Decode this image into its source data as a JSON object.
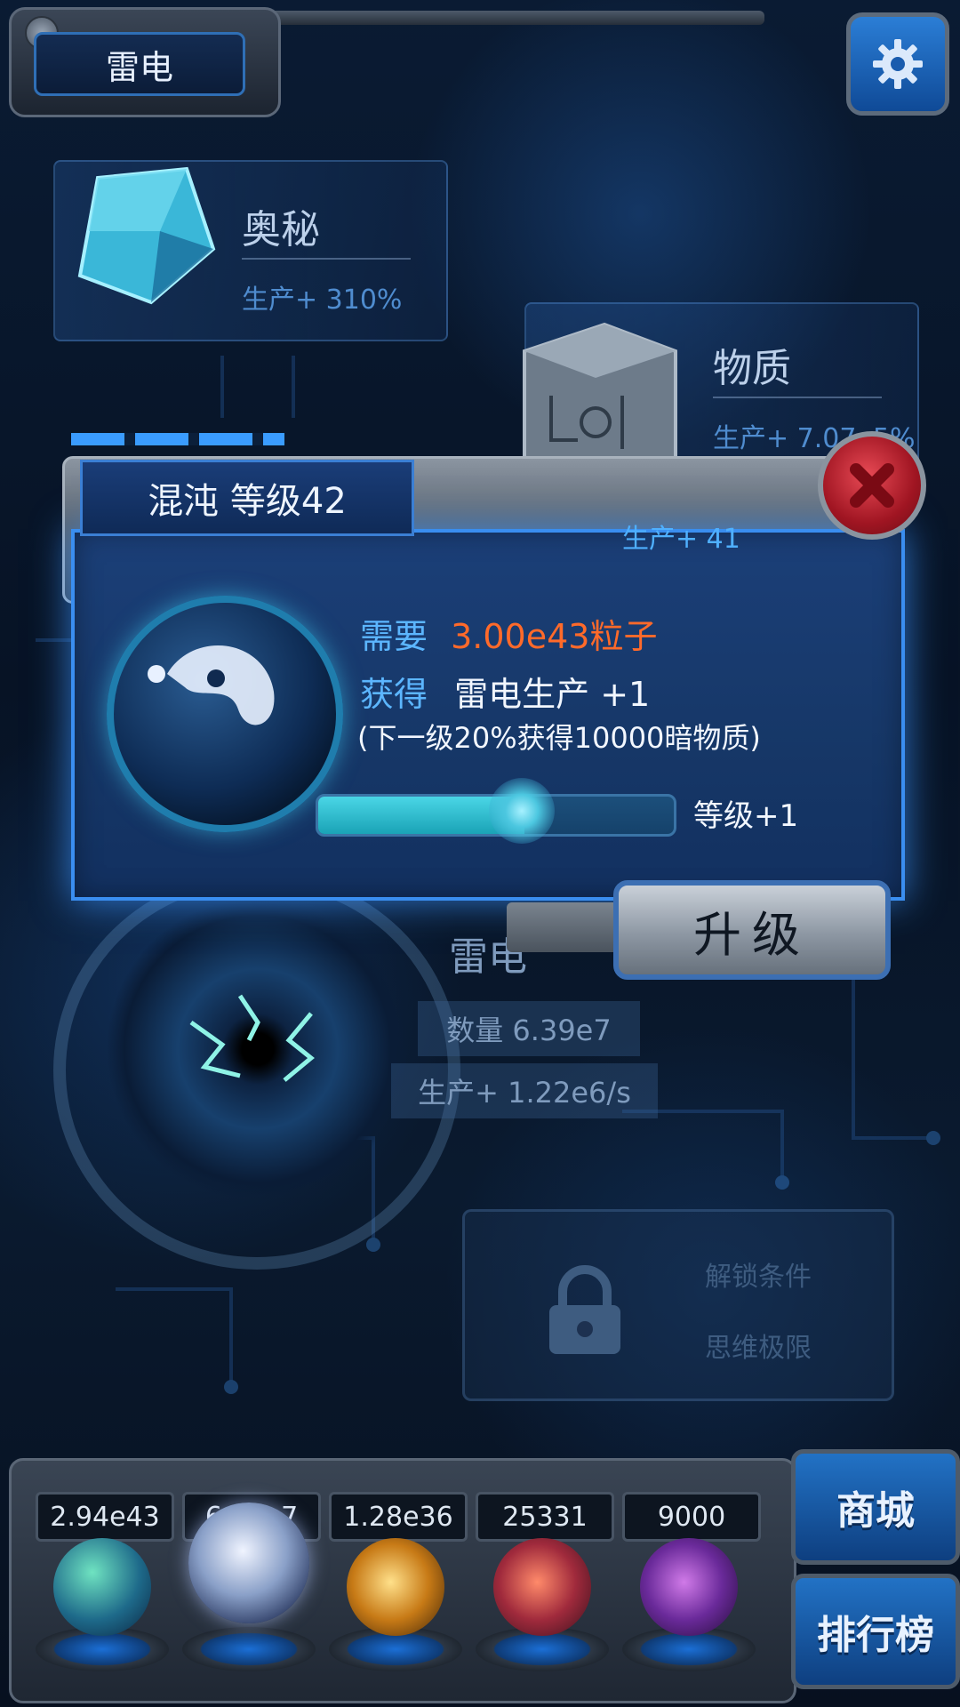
{
  "header": {
    "title": "雷电"
  },
  "cards": {
    "mystery": {
      "title": "奥秘",
      "stat": "生产+ 310%"
    },
    "matter": {
      "title": "物质",
      "stat": "生产+ 7.07e5%"
    }
  },
  "thunder": {
    "title": "雷电",
    "count": "数量 6.39e7",
    "production": "生产+ 1.22e6/s"
  },
  "locked_slot": {
    "line1": "解锁条件",
    "line2": "思维极限"
  },
  "dialog": {
    "title": "混沌 等级42",
    "production": "生产+ 41",
    "need_label": "需要",
    "need_value": "3.00e43粒子",
    "gain_label": "获得",
    "gain_value": "雷电生产 +1",
    "note": "(下一级20%获得10000暗物质)",
    "progress_fraction": 0.58,
    "level_up": "等级+1",
    "upgrade_label": "升级"
  },
  "resources": [
    {
      "value": "2.94e43",
      "icon": "green-atom-orb-icon"
    },
    {
      "value": "6.39e7",
      "icon": "lightning-orb-icon"
    },
    {
      "value": "1.28e36",
      "icon": "golden-nebula-orb-icon"
    },
    {
      "value": "25331",
      "icon": "red-brain-orb-icon"
    },
    {
      "value": "9000",
      "icon": "purple-vortex-orb-icon"
    }
  ],
  "side_buttons": {
    "shop": "商城",
    "ranking": "排行榜"
  },
  "colors": {
    "accent": "#3a8ef0",
    "need": "#ff6a2a",
    "label": "#5cb6ff"
  }
}
